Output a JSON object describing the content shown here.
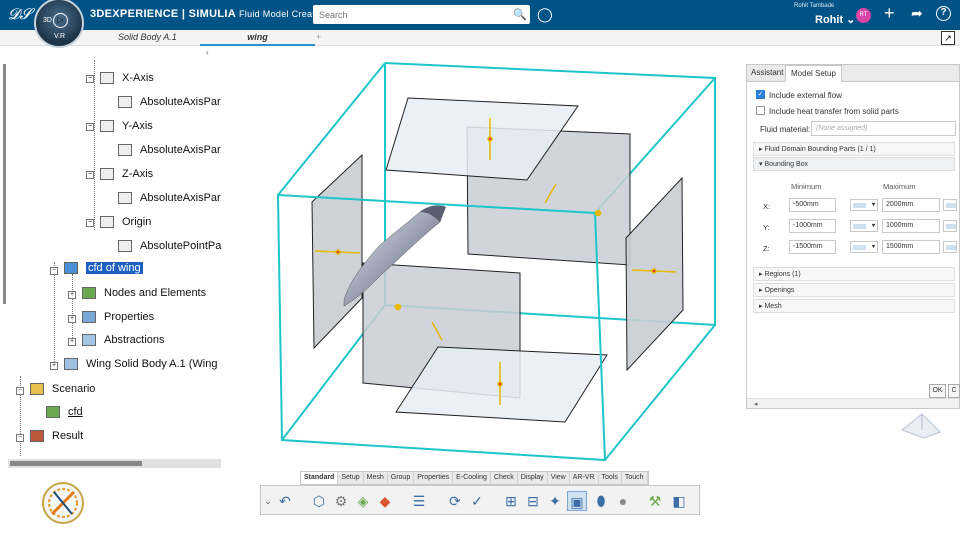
{
  "header": {
    "brand_bold": "3DEXPERIENCE | SIMULIA",
    "brand_sub": "Fluid Model Creation",
    "search_placeholder": "Search",
    "user_role": "Rohit Tambade",
    "user_name": "Rohit",
    "avatar_initials": "RT",
    "compass_label": "V.R",
    "compass_top": "3D"
  },
  "tabs": [
    "Solid Body A.1",
    "wing"
  ],
  "tree": {
    "items": [
      "X-Axis",
      "AbsoluteAxisPar",
      "Y-Axis",
      "AbsoluteAxisPar",
      "Z-Axis",
      "AbsoluteAxisPar",
      "Origin",
      "AbsolutePointPa",
      "cfd of wing",
      "Nodes and Elements",
      "Properties",
      "Abstractions",
      "Wing Solid Body A.1 (Wing",
      "Scenario",
      "cfd",
      "Result"
    ]
  },
  "panel": {
    "tabs": [
      "Assistant",
      "Model Setup"
    ],
    "include_external_flow": "Include external flow",
    "include_heat_transfer": "Include heat transfer from solid parts",
    "fluid_material_label": "Fluid material:",
    "fluid_material_value": "(None assigned)",
    "sections": [
      "Fluid Domain Bounding Parts (1 / 1)",
      "Bounding Box",
      "Regions (1)",
      "Openings",
      "Mesh"
    ],
    "min_label": "Minimum",
    "max_label": "Maximum",
    "rows": [
      {
        "axis": "X:",
        "min": "-500mm",
        "max": "2000mm"
      },
      {
        "axis": "Y:",
        "min": "-1000mm",
        "max": "1000mm"
      },
      {
        "axis": "Z:",
        "min": "-1500mm",
        "max": "1500mm"
      }
    ],
    "ok": "OK",
    "c": "C"
  },
  "toolbar": {
    "tabs": [
      "Standard",
      "Setup",
      "Mesh",
      "Group",
      "Properties",
      "E-Cooling",
      "Check",
      "Display",
      "View",
      "AR-VR",
      "Tools",
      "Touch"
    ]
  }
}
